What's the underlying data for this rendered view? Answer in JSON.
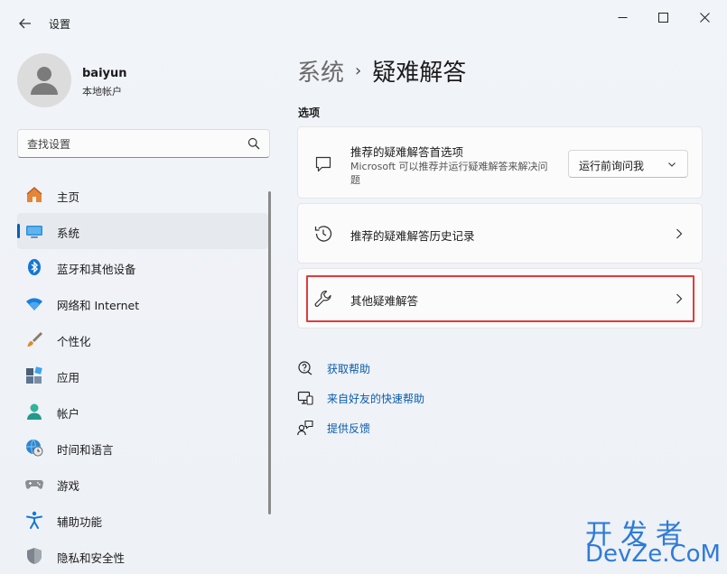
{
  "window": {
    "title": "设置"
  },
  "user": {
    "name": "baiyun",
    "account_type": "本地帐户"
  },
  "search": {
    "placeholder": "查找设置"
  },
  "nav": {
    "items": [
      {
        "label": "主页",
        "icon": "home-icon"
      },
      {
        "label": "系统",
        "icon": "system-icon"
      },
      {
        "label": "蓝牙和其他设备",
        "icon": "bluetooth-icon"
      },
      {
        "label": "网络和 Internet",
        "icon": "wifi-icon"
      },
      {
        "label": "个性化",
        "icon": "brush-icon"
      },
      {
        "label": "应用",
        "icon": "apps-icon"
      },
      {
        "label": "帐户",
        "icon": "account-icon"
      },
      {
        "label": "时间和语言",
        "icon": "globe-clock-icon"
      },
      {
        "label": "游戏",
        "icon": "gamepad-icon"
      },
      {
        "label": "辅助功能",
        "icon": "accessibility-icon"
      },
      {
        "label": "隐私和安全性",
        "icon": "shield-icon"
      }
    ],
    "active_index": 1
  },
  "breadcrumb": {
    "parent": "系统",
    "separator": "›",
    "current": "疑难解答"
  },
  "section": {
    "label": "选项"
  },
  "options": [
    {
      "title": "推荐的疑难解答首选项",
      "description": "Microsoft 可以推荐并运行疑难解答来解决问题",
      "icon": "chat-bubble-icon",
      "dropdown_value": "运行前询问我"
    },
    {
      "title": "推荐的疑难解答历史记录",
      "icon": "history-icon"
    },
    {
      "title": "其他疑难解答",
      "icon": "wrench-icon"
    }
  ],
  "help_links": [
    {
      "label": "获取帮助",
      "icon": "help-chat-icon"
    },
    {
      "label": "来自好友的快速帮助",
      "icon": "remote-assist-icon"
    },
    {
      "label": "提供反馈",
      "icon": "feedback-icon"
    }
  ],
  "watermark": {
    "line1": "开发者",
    "line2": "DevZe.CoM"
  },
  "colors": {
    "accent": "#005fb8",
    "link": "#0b5cad",
    "highlight_border": "#e03c3c",
    "watermark": "#2f7bd8"
  }
}
